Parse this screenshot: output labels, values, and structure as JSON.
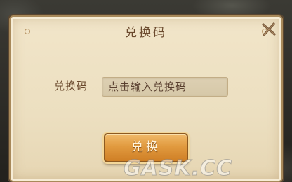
{
  "dialog": {
    "title": "兑换码",
    "close_icon": "close-x-icon"
  },
  "form": {
    "label": "兑换码",
    "placeholder": "点击输入兑换码"
  },
  "actions": {
    "redeem_label": "兑换"
  },
  "watermark": {
    "text": "GASK.CC"
  },
  "colors": {
    "panel": "#ecdfc0",
    "title_text": "#6b4a2e",
    "button": "#e19a3f",
    "button_text": "#fff4dc"
  }
}
